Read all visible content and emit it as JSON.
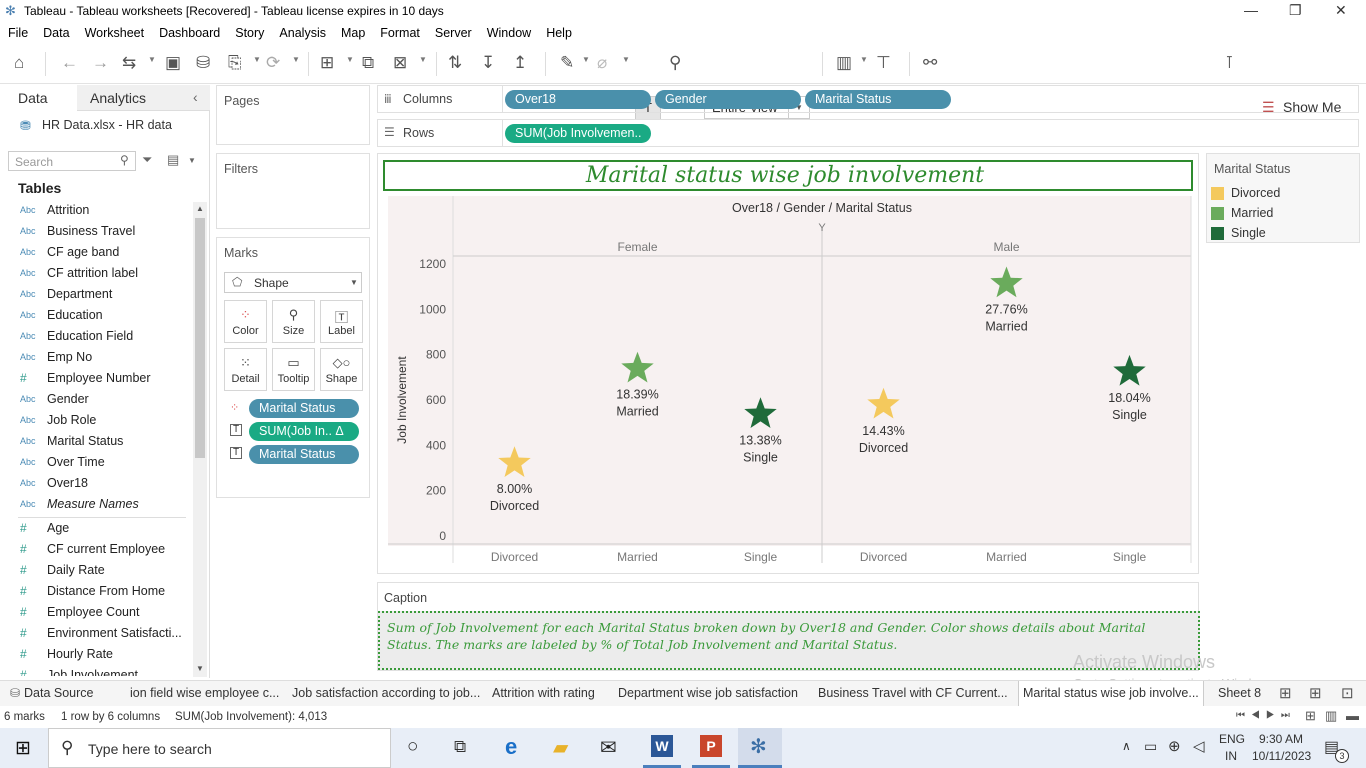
{
  "window": {
    "title": "Tableau - Tableau worksheets [Recovered] - Tableau license expires in 10 days",
    "minimize": "—",
    "restore": "❐",
    "close": "✕"
  },
  "menu": [
    "File",
    "Data",
    "Worksheet",
    "Dashboard",
    "Story",
    "Analysis",
    "Map",
    "Format",
    "Server",
    "Window",
    "Help"
  ],
  "toolbar": {
    "fit_label": "Entire View",
    "show_me": "Show Me"
  },
  "sidebar": {
    "tab_data": "Data",
    "tab_analytics": "Analytics",
    "datasource": "HR Data.xlsx - HR data",
    "search_placeholder": "Search",
    "tables_heading": "Tables",
    "dimensions": [
      {
        "type": "Abc",
        "name": "Attrition"
      },
      {
        "type": "Abc",
        "name": "Business Travel"
      },
      {
        "type": "Abc",
        "name": "CF age band"
      },
      {
        "type": "Abc",
        "name": "CF attrition label"
      },
      {
        "type": "Abc",
        "name": "Department"
      },
      {
        "type": "Abc",
        "name": "Education"
      },
      {
        "type": "Abc",
        "name": "Education Field"
      },
      {
        "type": "Abc",
        "name": "Emp No"
      },
      {
        "type": "#",
        "name": "Employee Number"
      },
      {
        "type": "Abc",
        "name": "Gender"
      },
      {
        "type": "Abc",
        "name": "Job Role"
      },
      {
        "type": "Abc",
        "name": "Marital Status"
      },
      {
        "type": "Abc",
        "name": "Over Time"
      },
      {
        "type": "Abc",
        "name": "Over18"
      },
      {
        "type": "Abc",
        "name": "Measure Names"
      }
    ],
    "measures": [
      {
        "type": "#",
        "name": "Age"
      },
      {
        "type": "#",
        "name": "CF current Employee"
      },
      {
        "type": "#",
        "name": "Daily Rate"
      },
      {
        "type": "#",
        "name": "Distance From Home"
      },
      {
        "type": "#",
        "name": "Employee Count"
      },
      {
        "type": "#",
        "name": "Environment Satisfacti..."
      },
      {
        "type": "#",
        "name": "Hourly Rate"
      },
      {
        "type": "#",
        "name": "Job Involvement"
      }
    ]
  },
  "cards": {
    "pages": "Pages",
    "filters": "Filters",
    "marks": "Marks",
    "mark_type": "Shape",
    "buttons": {
      "color": "Color",
      "size": "Size",
      "label": "Label",
      "detail": "Detail",
      "tooltip": "Tooltip",
      "shape": "Shape"
    },
    "pills": [
      "Marital Status",
      "SUM(Job In..  Δ",
      "Marital Status"
    ]
  },
  "shelves": {
    "columns_label": "Columns",
    "rows_label": "Rows",
    "columns": [
      "Over18",
      "Gender",
      "Marital Status"
    ],
    "rows": [
      "SUM(Job Involvemen.."
    ]
  },
  "legend": {
    "title": "Marital Status",
    "items": [
      {
        "label": "Divorced",
        "color": "#f4c95d"
      },
      {
        "label": "Married",
        "color": "#6aab5c"
      },
      {
        "label": "Single",
        "color": "#1f6b3a"
      }
    ]
  },
  "caption": {
    "title": "Caption",
    "text": "Sum of Job Involvement for each Marital Status broken down by Over18 and Gender.  Color shows details about Marital Status.  The marks are labeled by % of Total Job Involvement and Marital Status."
  },
  "chart_data": {
    "type": "scatter",
    "title": "Marital status wise job involvement",
    "header": "Over18 / Gender / Marital Status",
    "over18_value": "Y",
    "ylabel": "Job Involvement",
    "ylim": [
      0,
      1200
    ],
    "yticks": [
      0,
      200,
      400,
      600,
      800,
      1000,
      1200
    ],
    "mark_shape": "star",
    "panes": [
      {
        "gender": "Female",
        "points": [
          {
            "category": "Divorced",
            "value": 321,
            "label_pct": "8.00%",
            "label_status": "Divorced",
            "color": "#f4c95d"
          },
          {
            "category": "Married",
            "value": 738,
            "label_pct": "18.39%",
            "label_status": "Married",
            "color": "#6aab5c"
          },
          {
            "category": "Single",
            "value": 537,
            "label_pct": "13.38%",
            "label_status": "Single",
            "color": "#1f6b3a"
          }
        ]
      },
      {
        "gender": "Male",
        "points": [
          {
            "category": "Divorced",
            "value": 579,
            "label_pct": "14.43%",
            "label_status": "Divorced",
            "color": "#f4c95d"
          },
          {
            "category": "Married",
            "value": 1114,
            "label_pct": "27.76%",
            "label_status": "Married",
            "color": "#6aab5c"
          },
          {
            "category": "Single",
            "value": 724,
            "label_pct": "18.04%",
            "label_status": "Single",
            "color": "#1f6b3a"
          }
        ]
      }
    ]
  },
  "sheet_tabs": [
    "Data Source",
    "ion field wise employee c...",
    "Job satisfaction according to job...",
    "Attrition with rating",
    "Department wise job satisfaction",
    "Business Travel with CF Current...",
    "Marital status wise job involve...",
    "Sheet 8"
  ],
  "status": {
    "marks": "6 marks",
    "rows_cols": "1 row by 6 columns",
    "sum": "SUM(Job Involvement): 4,013"
  },
  "watermark": {
    "line1": "Activate Windows",
    "line2": "Go to Settings to activate Windows."
  },
  "taskbar": {
    "search_placeholder": "Type here to search",
    "lang1": "ENG",
    "lang2": "IN",
    "time": "9:30 AM",
    "date": "10/11/2023",
    "notif_count": "3"
  }
}
